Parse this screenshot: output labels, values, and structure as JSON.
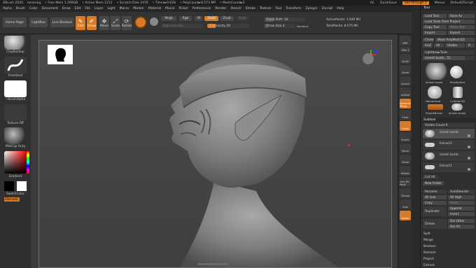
{
  "titlebar": {
    "app": "ZBrush 2020",
    "project": "larsenkg",
    "free_mem": "• Free Mem 1.299GB",
    "active_mem": "• Active Mem 1212",
    "scratch": "• Scratch Disk 2476",
    "timer": "• Timer►0.628",
    "polycount": "• PolyCount►8.573 MP",
    "meshcount": "• MeshCount►5",
    "ac": "AC",
    "quicksave": "QuickSave",
    "seethrough": "See-through",
    "seethrough_val": "0",
    "menus_label": "Menus",
    "script": "DefaultZScript"
  },
  "menubar": [
    "Alpha",
    "Brush",
    "Color",
    "Document",
    "Draw",
    "Edit",
    "File",
    "Layer",
    "Light",
    "Macro",
    "Marker",
    "Material",
    "Movie",
    "Picker",
    "Preferences",
    "Render",
    "Stencil",
    "Stroke",
    "Texture",
    "Tool",
    "Transform",
    "Zplugin",
    "Zscript",
    "Help"
  ],
  "toptool": {
    "home": "Home Page",
    "lightbox": "LightBox",
    "live_boolean": "Live Boolean",
    "edit": "Edit",
    "draw": "Draw",
    "move": "Move",
    "scale": "Scale",
    "rotate": "Rotate",
    "mrgb": "Mrgb",
    "rgb": "Rgb",
    "m": "M",
    "zadd": "Zadd",
    "zsub": "Zsub",
    "zcut": "Zcut",
    "rgb_intensity": "Rgb Intensity",
    "z_intensity": "Z Intensity 20",
    "focal_shift": "Focal Shift -56",
    "draw_size": "Draw Size 4",
    "dynamic": "Dynamic",
    "active_points": "ActivePoints: 3.646 Mil",
    "total_points": "TotalPoints: 8.575 Mil"
  },
  "leftshelf": {
    "brush": "ClayBuildup",
    "stroke": "FreeHand",
    "alpha": "~BrushAlpha",
    "texture": "Texture Off",
    "material": "MatCap Gray",
    "gradient": "Gradient",
    "switch_color": "SwitchColor",
    "alternate": "Alternate"
  },
  "rightshelf": [
    "BPR",
    "SPix 3",
    "Scroll",
    "Zoom",
    "Actual",
    "AAHalf",
    "Dynamic Persp",
    "Floor",
    "Local",
    "Frame",
    "Move",
    "Scale",
    "Rotate",
    "Line Fill PolyF",
    "Transp",
    "Solo",
    "Xpose"
  ],
  "rightpanel": {
    "header": "Tool",
    "load_tool": "Load Tool",
    "save_as": "Save As",
    "load_from_project": "Load Tools From Project",
    "copy_tool": "Copy Tool",
    "paste_tool": "Paste Tool",
    "import": "Import",
    "export": "Export",
    "clone": "Clone",
    "make_polymesh": "Make PolyMesh3D",
    "goz": "GoZ",
    "all": "All",
    "visible": "Visible",
    "r": "R",
    "lightbox_tools": "Lightbox►Tools",
    "tool_name": "ionesh busto . 51",
    "thumbs": [
      "ionesh busto",
      "PolySphere",
      "DemoHead",
      "Cylinder3D",
      "SimpleBrush",
      "ionesh busto"
    ],
    "subtool_header": "Subtool",
    "visible_count": "Visible Count 8",
    "subtools": [
      "ionesh busto",
      "Extract3",
      "ionesh busto",
      "Extract1"
    ],
    "list_all": "List All",
    "new_folder": "New Folder",
    "rename": "Rename",
    "autoreorder": "AutoReorder",
    "all_low": "All Low",
    "all_high": "All High",
    "copy": "Copy",
    "paste": "Paste",
    "duplicate": "Duplicate",
    "append": "Append",
    "insert": "Insert",
    "delete": "Delete",
    "del_other": "Del Other",
    "del_all": "Del All",
    "split": "Split",
    "merge": "Merge",
    "boolean": "Boolean",
    "remesh": "Remesh",
    "project": "Project",
    "extract": "Extract"
  }
}
